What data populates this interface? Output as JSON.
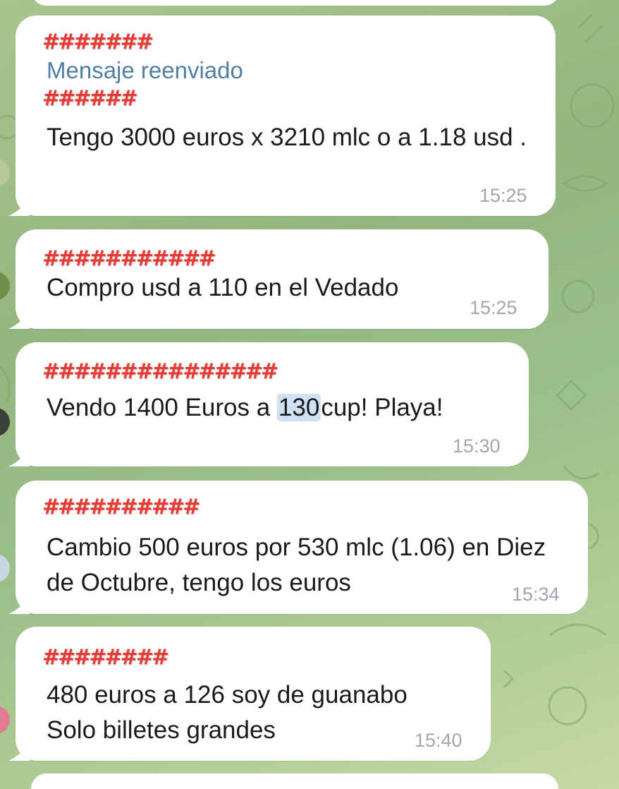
{
  "colors": {
    "sender_name": "#e53935",
    "forward_label": "#4f7fa3",
    "message_text": "#1a1a1a",
    "time_text": "#a1a6ac",
    "bubble": "#ffffff",
    "highlight": "#cfe1f3"
  },
  "messages": [
    {
      "sender": "#######",
      "forward_label": "Mensaje reenviado",
      "forward_from": "######",
      "text": "Tengo 3000 euros x 3210 mlc o a 1.18 usd .",
      "time": "15:25"
    },
    {
      "sender": "###########",
      "text": "Compro usd a 110 en el Vedado",
      "time": "15:25"
    },
    {
      "sender": "###############",
      "text_before": "Vendo 1400 Euros a ",
      "text_highlight": "130",
      "text_after": "cup! Playa!",
      "time": "15:30"
    },
    {
      "sender": "##########",
      "text": "Cambio 500 euros por 530 mlc (1.06) en Diez de Octubre, tengo los euros",
      "time": "15:34"
    },
    {
      "sender": "########",
      "text_line1": "480 euros a 126 soy de guanabo",
      "text_line2": "Solo billetes grandes",
      "time": "15:40"
    }
  ]
}
